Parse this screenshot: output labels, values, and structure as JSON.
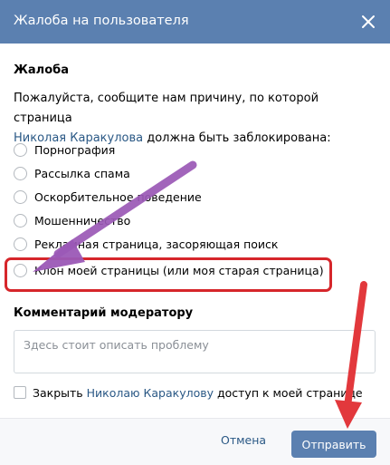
{
  "dialog": {
    "title": "Жалоба на пользователя",
    "close_icon": "close-icon"
  },
  "complaint": {
    "heading": "Жалоба",
    "intro_before": "Пожалуйста, сообщите нам причину, по которой страница",
    "user_link": "Николая Каракулова",
    "intro_after": " должна быть заблокирована:",
    "options": [
      "Порнография",
      "Рассылка спама",
      "Оскорбительное поведение",
      "Мошенничество",
      "Рекламная страница, засоряющая поиск",
      "Клон моей страницы (или моя старая страница)"
    ]
  },
  "moderator": {
    "heading": "Комментарий модератору",
    "placeholder": "Здесь стоит описать проблему"
  },
  "close_access": {
    "before": "Закрыть ",
    "user_link": "Николаю Каракулову",
    "after": " доступ к моей странице"
  },
  "footer": {
    "cancel_label": "Отмена",
    "submit_label": "Отправить"
  },
  "colors": {
    "header": "#5b80b0",
    "link": "#2a5885",
    "highlight": "#d6262b",
    "purple_arrow": "#9b59b6",
    "red_arrow": "#e2383c"
  }
}
